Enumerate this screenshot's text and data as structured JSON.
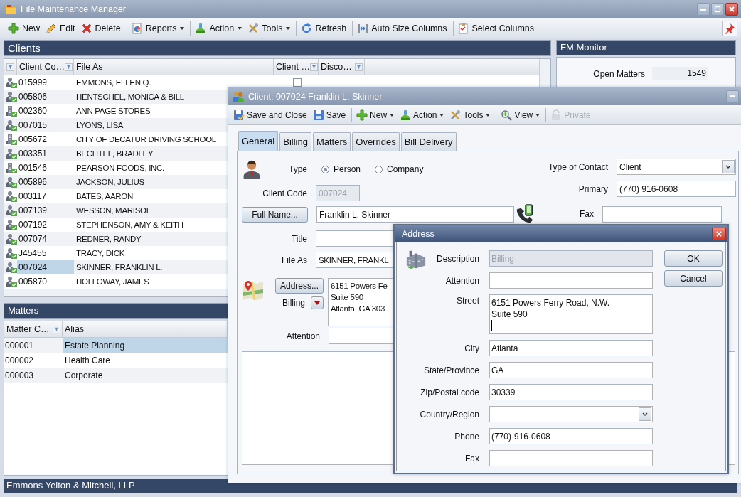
{
  "window": {
    "title": "File Maintenance Manager"
  },
  "toolbar": [
    {
      "label": "New",
      "dropdown": false,
      "group_start": false
    },
    {
      "label": "Edit",
      "dropdown": false,
      "group_start": false
    },
    {
      "label": "Delete",
      "dropdown": false,
      "group_start": false
    },
    {
      "label": "Reports",
      "dropdown": true,
      "group_start": true
    },
    {
      "label": "Action",
      "dropdown": true,
      "group_start": true
    },
    {
      "label": "Tools",
      "dropdown": true,
      "group_start": false
    },
    {
      "label": "Refresh",
      "dropdown": false,
      "group_start": true
    },
    {
      "label": "Auto Size Columns",
      "dropdown": false,
      "group_start": true
    },
    {
      "label": "Select Columns",
      "dropdown": false,
      "group_start": true
    }
  ],
  "clients": {
    "title": "Clients",
    "columns": [
      {
        "filter": true
      },
      {
        "label": "Client Co…",
        "filter": true
      },
      {
        "label": "File As",
        "filter": false
      },
      {
        "label": "Client …",
        "filter": true
      },
      {
        "label": "Disco…",
        "filter": true
      }
    ],
    "rows": [
      {
        "kind": "person",
        "code": "015999",
        "file_as": "EMMONS, ELLEN Q.",
        "selected": false,
        "flag": {
          "checked": false
        }
      },
      {
        "kind": "person",
        "code": "005806",
        "file_as": "HENTSCHEL, MONICA & BILL",
        "selected": false
      },
      {
        "kind": "company",
        "code": "002360",
        "file_as": "ANN PAGE STORES",
        "selected": false
      },
      {
        "kind": "person",
        "code": "007015",
        "file_as": "LYONS, LISA",
        "selected": false
      },
      {
        "kind": "company",
        "code": "005672",
        "file_as": "CITY OF DECATUR DRIVING SCHOOL",
        "selected": false
      },
      {
        "kind": "person",
        "code": "003351",
        "file_as": "BECHTEL, BRADLEY",
        "selected": false
      },
      {
        "kind": "company",
        "code": "001546",
        "file_as": "PEARSON FOODS, INC.",
        "selected": false
      },
      {
        "kind": "person",
        "code": "005896",
        "file_as": "JACKSON, JULIUS",
        "selected": false
      },
      {
        "kind": "person",
        "code": "003117",
        "file_as": "BATES, AARON",
        "selected": false
      },
      {
        "kind": "person",
        "code": "007139",
        "file_as": "WESSON, MARISOL",
        "selected": false
      },
      {
        "kind": "person",
        "code": "007192",
        "file_as": "STEPHENSON, AMY & KEITH",
        "selected": false
      },
      {
        "kind": "person",
        "code": "007074",
        "file_as": "REDNER, RANDY",
        "selected": false
      },
      {
        "kind": "person",
        "code": "J45455",
        "file_as": "TRACY, DICK",
        "selected": false
      },
      {
        "kind": "person",
        "code": "007024",
        "file_as": "SKINNER, FRANKLIN L.",
        "selected": true
      },
      {
        "kind": "person",
        "code": "005870",
        "file_as": "HOLLOWAY, JAMES",
        "selected": false
      }
    ]
  },
  "matters": {
    "title": "Matters",
    "columns": [
      {
        "label": "Matter C…",
        "filter": true
      },
      {
        "label": "Alias",
        "filter": false
      }
    ],
    "rows": [
      {
        "code": "000001",
        "alias": "Estate Planning",
        "selected": true
      },
      {
        "code": "000002",
        "alias": "Health Care",
        "selected": false
      },
      {
        "code": "000003",
        "alias": "Corporate",
        "selected": false
      }
    ]
  },
  "monitor": {
    "title": "FM Monitor",
    "items": [
      {
        "label": "Open Matters",
        "value": "1549"
      }
    ]
  },
  "status_bar": "Emmons Yelton & Mitchell, LLP",
  "client_dialog": {
    "title": "Client: 007024 Franklin L. Skinner",
    "toolbar": [
      {
        "label": "Save and Close",
        "dropdown": false,
        "group_start": false,
        "disabled": false
      },
      {
        "label": "Save",
        "dropdown": false,
        "group_start": false,
        "disabled": false
      },
      {
        "label": "New",
        "dropdown": true,
        "group_start": true,
        "disabled": false
      },
      {
        "label": "Action",
        "dropdown": true,
        "group_start": false,
        "disabled": false
      },
      {
        "label": "Tools",
        "dropdown": true,
        "group_start": false,
        "disabled": false
      },
      {
        "label": "View",
        "dropdown": true,
        "group_start": true,
        "disabled": false
      },
      {
        "label": "Private",
        "dropdown": false,
        "group_start": true,
        "disabled": true
      }
    ],
    "tabs": [
      {
        "label": "General",
        "selected": true
      },
      {
        "label": "Billing",
        "selected": false
      },
      {
        "label": "Matters",
        "selected": false
      },
      {
        "label": "Overrides",
        "selected": false
      },
      {
        "label": "Bill Delivery",
        "selected": false
      }
    ],
    "general": {
      "type_label": "Type",
      "type_options": [
        {
          "label": "Person",
          "selected": true
        },
        {
          "label": "Company",
          "selected": false
        }
      ],
      "client_code_label": "Client Code",
      "client_code": "007024",
      "full_name_button": "Full Name...",
      "full_name": "Franklin L. Skinner",
      "title_label": "Title",
      "file_as_label": "File As",
      "file_as": "SKINNER, FRANKL",
      "address_button": "Address...",
      "address_type": "Billing",
      "address_lines": [
        "6151 Powers Fe",
        "Suite 590",
        "Atlanta, GA 303"
      ],
      "attention_label": "Attention",
      "contact_type_label": "Type of Contact",
      "contact_type": "Client",
      "primary_label": "Primary",
      "primary": "(770) 916-0608",
      "fax_label": "Fax"
    }
  },
  "address_dialog": {
    "title": "Address",
    "fields": [
      {
        "label": "Description",
        "kind": "text",
        "value": "Billing",
        "disabled": true
      },
      {
        "label": "Attention",
        "kind": "text",
        "disabled": false
      },
      {
        "label": "Street",
        "kind": "multiline",
        "lines": [
          "6151 Powers Ferry Road, N.W.",
          "Suite 590"
        ],
        "disabled": false
      },
      {
        "label": "City",
        "kind": "text",
        "value": "Atlanta",
        "disabled": false
      },
      {
        "label": "State/Province",
        "kind": "text",
        "value": "GA",
        "disabled": false
      },
      {
        "label": "Zip/Postal code",
        "kind": "text",
        "value": "30339",
        "disabled": false
      },
      {
        "label": "Country/Region",
        "kind": "select",
        "disabled": false
      },
      {
        "label": "Phone",
        "kind": "text",
        "value": "(770)-916-0608",
        "disabled": false
      },
      {
        "label": "Fax",
        "kind": "text",
        "disabled": false
      }
    ],
    "buttons": [
      "OK",
      "Cancel"
    ]
  }
}
